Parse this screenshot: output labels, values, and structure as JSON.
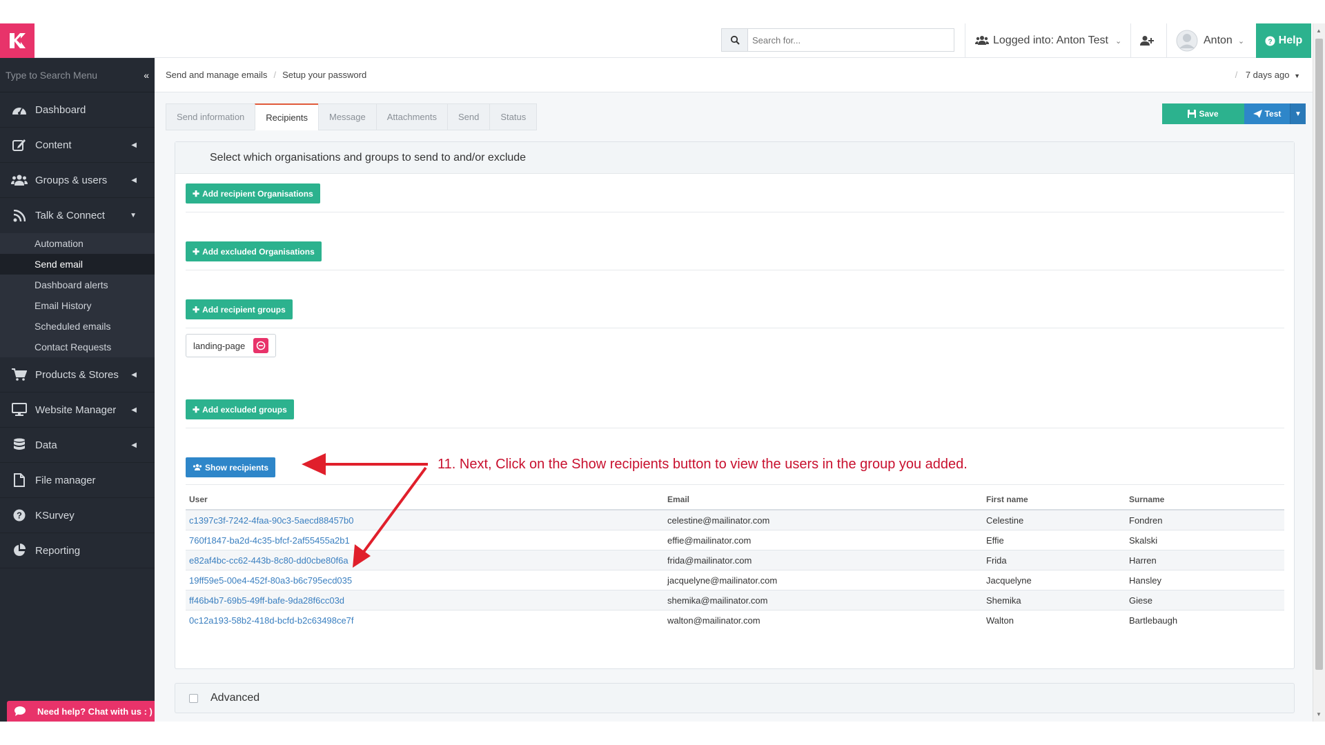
{
  "topbar": {
    "search_placeholder": "Search for...",
    "logged_into": "Logged into: Anton Test",
    "user_name": "Anton",
    "help_label": "Help"
  },
  "sidebar": {
    "search_label": "Type to Search Menu",
    "items": [
      {
        "label": "Dashboard",
        "icon": "dashboard-icon"
      },
      {
        "label": "Content",
        "icon": "edit-icon"
      },
      {
        "label": "Groups & users",
        "icon": "users-icon"
      },
      {
        "label": "Talk & Connect",
        "icon": "rss-icon"
      },
      {
        "label": "Products & Stores",
        "icon": "cart-icon"
      },
      {
        "label": "Website Manager",
        "icon": "monitor-icon"
      },
      {
        "label": "Data",
        "icon": "database-icon"
      },
      {
        "label": "File manager",
        "icon": "file-icon"
      },
      {
        "label": "KSurvey",
        "icon": "question-icon"
      },
      {
        "label": "Reporting",
        "icon": "pie-chart-icon"
      }
    ],
    "submenu": [
      "Automation",
      "Send email",
      "Dashboard alerts",
      "Email History",
      "Scheduled emails",
      "Contact Requests"
    ]
  },
  "breadcrumb": {
    "items": [
      "Send and manage emails",
      "Setup your password"
    ],
    "right": "7 days ago"
  },
  "tabs": [
    "Send information",
    "Recipients",
    "Message",
    "Attachments",
    "Send",
    "Status"
  ],
  "actions": {
    "save": "Save",
    "test": "Test"
  },
  "panel": {
    "title": "Select which organisations and groups to send to and/or exclude",
    "add_recipient_orgs": "Add recipient Organisations",
    "add_excluded_orgs": "Add excluded Organisations",
    "add_recipient_groups": "Add recipient groups",
    "group_tag": "landing-page",
    "add_excluded_groups": "Add excluded groups",
    "show_recipients": "Show recipients"
  },
  "table": {
    "headers": [
      "User",
      "Email",
      "First name",
      "Surname"
    ],
    "rows": [
      [
        "c1397c3f-7242-4faa-90c3-5aecd88457b0",
        "celestine@mailinator.com",
        "Celestine",
        "Fondren"
      ],
      [
        "760f1847-ba2d-4c35-bfcf-2af55455a2b1",
        "effie@mailinator.com",
        "Effie",
        "Skalski"
      ],
      [
        "e82af4bc-cc62-443b-8c80-dd0cbe80f6a",
        "frida@mailinator.com",
        "Frida",
        "Harren"
      ],
      [
        "19ff59e5-00e4-452f-80a3-b6c795ecd035",
        "jacquelyne@mailinator.com",
        "Jacquelyne",
        "Hansley"
      ],
      [
        "ff46b4b7-69b5-49ff-bafe-9da28f6cc03d",
        "shemika@mailinator.com",
        "Shemika",
        "Giese"
      ],
      [
        "0c12a193-58b2-418d-bcfd-b2c63498ce7f",
        "walton@mailinator.com",
        "Walton",
        "Bartlebaugh"
      ]
    ]
  },
  "advanced_label": "Advanced",
  "chat_label": "Need help? Chat with us : )",
  "annotation": "11. Next, Click on the Show recipients button to view the users in the group you added.",
  "colors": {
    "accent_pink": "#e8336a",
    "green": "#2cb28e",
    "blue": "#2e86c9",
    "sidebar": "#252a33",
    "annotation_red": "#c8102e"
  }
}
